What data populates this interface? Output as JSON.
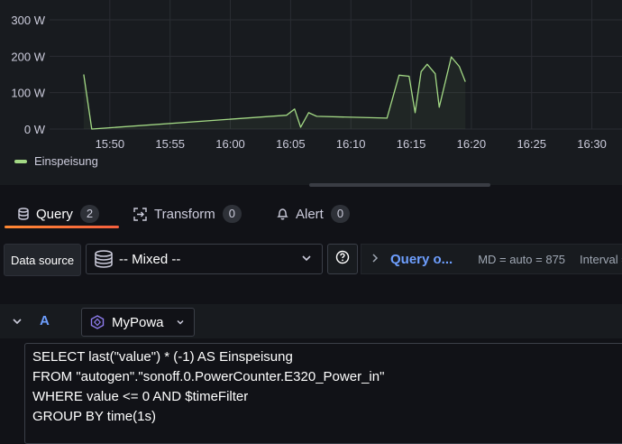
{
  "chart_data": {
    "type": "line",
    "y_ticks": [
      "300 W",
      "200 W",
      "100 W",
      "0 W"
    ],
    "x_ticks": [
      "15:50",
      "15:55",
      "16:00",
      "16:05",
      "16:10",
      "16:15",
      "16:20",
      "16:25",
      "16:30"
    ],
    "ylim": [
      0,
      300
    ],
    "xlim": [
      "15:45:00",
      "16:32:30"
    ],
    "grid": true,
    "legend_position": "bottom-left",
    "series": [
      {
        "name": "Einspeisung",
        "color": "#a3d985",
        "points": [
          [
            "15:47:50",
            150
          ],
          [
            "15:48:30",
            0
          ],
          [
            "16:04:40",
            38
          ],
          [
            "16:05:20",
            55
          ],
          [
            "16:05:50",
            5
          ],
          [
            "16:06:30",
            45
          ],
          [
            "16:07:10",
            35
          ],
          [
            "16:13:00",
            30
          ],
          [
            "16:14:00",
            148
          ],
          [
            "16:14:50",
            145
          ],
          [
            "16:15:20",
            45
          ],
          [
            "16:15:50",
            158
          ],
          [
            "16:16:20",
            178
          ],
          [
            "16:17:00",
            152
          ],
          [
            "16:17:20",
            60
          ],
          [
            "16:18:20",
            198
          ],
          [
            "16:19:00",
            172
          ],
          [
            "16:19:30",
            130
          ]
        ]
      }
    ]
  },
  "legend": {
    "label": "Einspeisung",
    "color": "#a3d985"
  },
  "tabs": [
    {
      "label": "Query",
      "count": "2",
      "icon": "database-icon",
      "active": true
    },
    {
      "label": "Transform",
      "count": "0",
      "icon": "transform-icon",
      "active": false
    },
    {
      "label": "Alert",
      "count": "0",
      "icon": "bell-icon",
      "active": false
    }
  ],
  "query_bar": {
    "data_source_label": "Data source",
    "data_source_value": "-- Mixed --",
    "query_options_label": "Query o...",
    "md": "MD = auto = 875",
    "interval": "Interval ="
  },
  "query": {
    "ref_id": "A",
    "datasource": "MyPowa",
    "lines": [
      "SELECT last(\"value\") * (-1) AS Einspeisung",
      "FROM \"autogen\".\"sonoff.0.PowerCounter.E320_Power_in\"",
      "WHERE value <= 0 AND $timeFilter",
      "GROUP BY time(1s)"
    ]
  },
  "colors": {
    "accent": "#6e9fff",
    "tab_underline_start": "#ff8833",
    "tab_underline_end": "#f55f3e",
    "series": "#a3d985"
  }
}
